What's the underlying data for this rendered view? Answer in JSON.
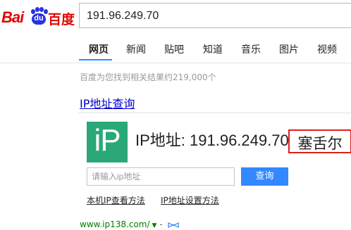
{
  "logo": {
    "bai_text": "Bai",
    "paw_text": "du",
    "chinese_text": "百度"
  },
  "search": {
    "query": "191.96.249.70"
  },
  "tabs": [
    {
      "label": "网页"
    },
    {
      "label": "新闻"
    },
    {
      "label": "贴吧"
    },
    {
      "label": "知道"
    },
    {
      "label": "音乐"
    },
    {
      "label": "图片"
    },
    {
      "label": "视频"
    }
  ],
  "results": {
    "count_text": "百度为您找到相关结果约219,000个"
  },
  "ip_result": {
    "title": "IP地址查询",
    "logo_text": "iP",
    "ip_line": "IP地址: 191.96.249.70",
    "location": "塞舌尔",
    "input_placeholder": "请输入ip地址",
    "query_button": "查询",
    "help_links": [
      {
        "label": "本机IP查看方法"
      },
      {
        "label": "IP地址设置方法"
      }
    ],
    "source_url": "www.ip138.com/",
    "source_arrow": "▼",
    "source_dash": "-"
  },
  "colors": {
    "brand_red": "#e10601",
    "brand_blue": "#2932e1",
    "link_blue": "#0000cc",
    "ip_green": "#2ba877",
    "button_blue": "#3388ff",
    "highlight_red": "#e02020",
    "url_green": "#008000"
  }
}
